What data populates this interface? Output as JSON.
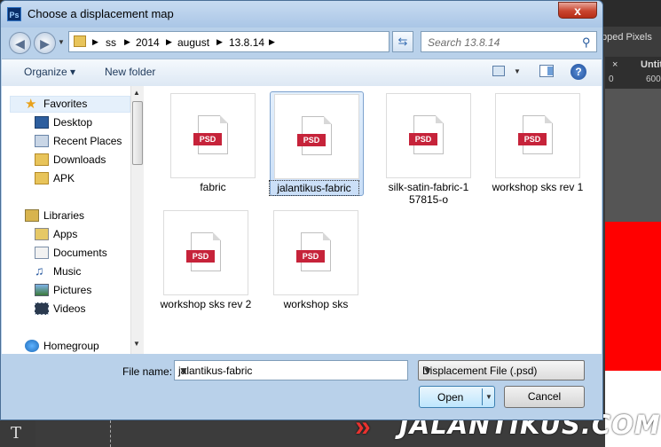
{
  "dialog": {
    "title": "Choose a displacement map",
    "app_icon": "Ps",
    "close_label": "x"
  },
  "address": {
    "crumbs": [
      "ss",
      "2014",
      "august",
      "13.8.14"
    ],
    "search_placeholder": "Search 13.8.14"
  },
  "toolbar": {
    "organize_label": "Organize ▾",
    "new_folder_label": "New folder",
    "help_label": "?"
  },
  "nav": {
    "items": [
      {
        "label": "Favorites",
        "icon": "star-icon"
      },
      {
        "label": "Desktop",
        "icon": "desktop-icon"
      },
      {
        "label": "Recent Places",
        "icon": "recent-places-icon"
      },
      {
        "label": "Downloads",
        "icon": "downloads-folder-icon"
      },
      {
        "label": "APK",
        "icon": "folder-icon"
      },
      {
        "label": "Libraries",
        "icon": "libraries-icon"
      },
      {
        "label": "Apps",
        "icon": "library-folder-icon"
      },
      {
        "label": "Documents",
        "icon": "documents-icon"
      },
      {
        "label": "Music",
        "icon": "music-icon"
      },
      {
        "label": "Pictures",
        "icon": "pictures-icon"
      },
      {
        "label": "Videos",
        "icon": "videos-icon"
      },
      {
        "label": "Homegroup",
        "icon": "homegroup-icon"
      }
    ]
  },
  "files": [
    {
      "name": "fabric",
      "badge": "PSD",
      "selected": false
    },
    {
      "name": "jalantikus-fabric",
      "badge": "PSD",
      "selected": true
    },
    {
      "name": "silk-satin-fabric-1 57815-o",
      "badge": "PSD",
      "selected": false
    },
    {
      "name": "workshop sks rev 1",
      "badge": "PSD",
      "selected": false
    },
    {
      "name": "workshop sks rev 2",
      "badge": "PSD",
      "selected": false
    },
    {
      "name": "workshop sks",
      "badge": "PSD",
      "selected": false
    }
  ],
  "bottom": {
    "file_name_label": "File name:",
    "file_name_value": "jalantikus-fabric",
    "file_type_value": "Displacement File (.psd)",
    "open_label": "Open",
    "cancel_label": "Cancel"
  },
  "background": {
    "top_right_label": "pped Pixels",
    "tab_label": "Untit",
    "ruler_numbers": [
      "0",
      "600"
    ],
    "tool_glyph": "T",
    "watermark": "JALANTIKUS.COM",
    "watermark_color": "#e8322f"
  },
  "colors": {
    "selection": "#c9def7",
    "psd_badge": "#c6233a"
  }
}
